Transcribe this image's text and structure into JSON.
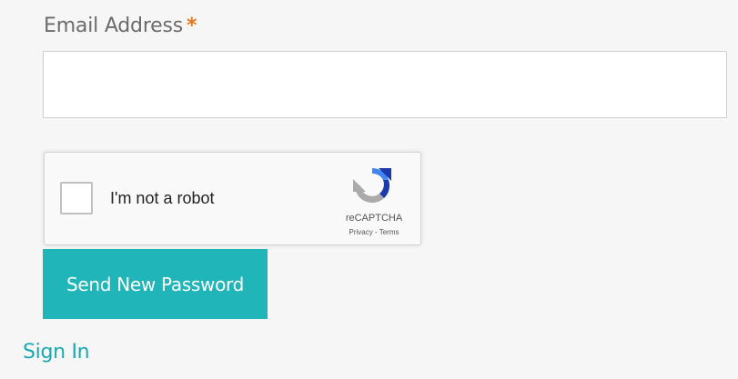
{
  "form": {
    "email_label": "Email Address",
    "required_marker": "*",
    "email_value": "",
    "email_placeholder": "",
    "submit_label": "Send New Password",
    "sign_in_link": "Sign In"
  },
  "recaptcha": {
    "checkbox_label": "I'm not a robot",
    "brand": "reCAPTCHA",
    "privacy_link": "Privacy",
    "separator": "-",
    "terms_link": "Terms",
    "checked": false
  },
  "colors": {
    "accent": "#20b5b8",
    "link": "#1aa9b0",
    "required": "#e07b24",
    "background": "#f6f6f6",
    "recaptcha_blue": "#1c3aa9",
    "recaptcha_light_blue": "#4285f4",
    "recaptcha_gray": "#ababab"
  },
  "icons": {
    "recaptcha_logo": "recaptcha-logo-icon"
  }
}
